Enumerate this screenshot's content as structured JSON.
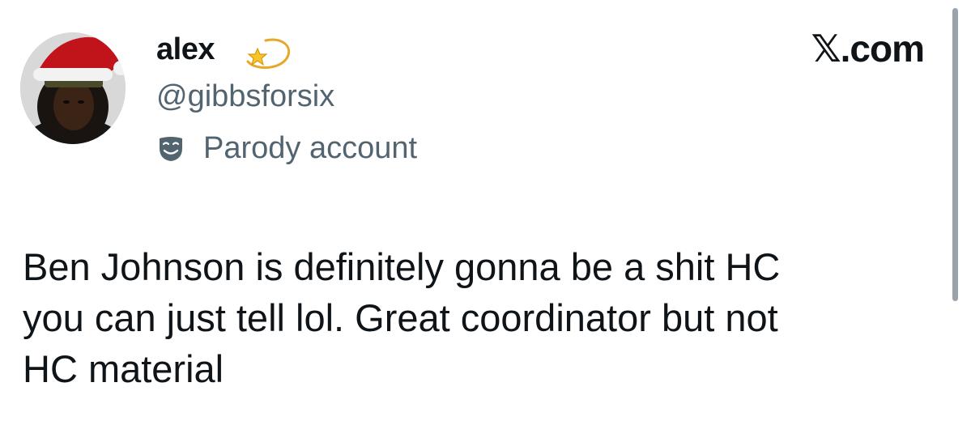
{
  "author": {
    "display_name": "alex",
    "handle": "@gibbsforsix",
    "label": "Parody account",
    "label_icon": "theater-masks-icon",
    "name_emoji": "dizzy-star-icon"
  },
  "brand": "𝕏.com",
  "tweet": {
    "text": "Ben Johnson is definitely gonna be a shit HC\nyou can just tell lol. Great coordinator but not\nHC material"
  },
  "colors": {
    "text_primary": "#0f1419",
    "text_secondary": "#536471",
    "background": "#ffffff"
  }
}
